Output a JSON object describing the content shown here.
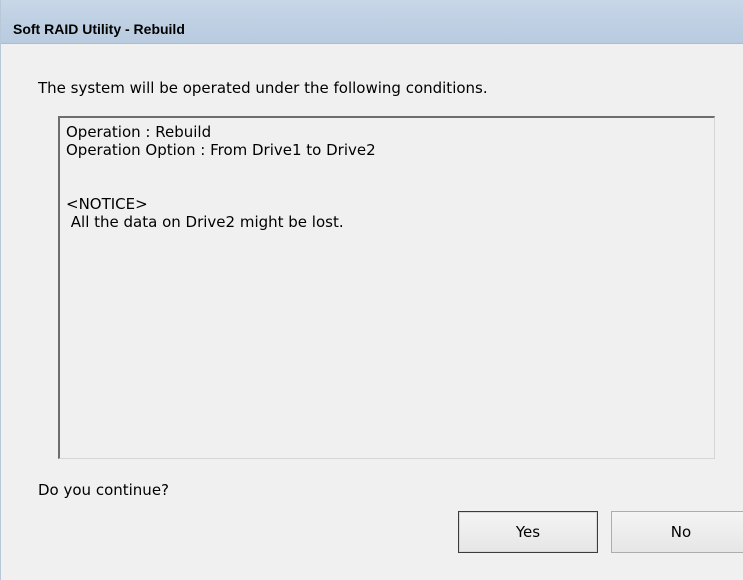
{
  "window": {
    "title": "Soft RAID Utility - Rebuild"
  },
  "dialog": {
    "intro": "The system will be operated under the following conditions.",
    "details": {
      "operation": "Operation : Rebuild",
      "option": "Operation Option : From Drive1 to Drive2",
      "notice_header": "<NOTICE>",
      "notice_text": " All the data on Drive2 might be lost."
    },
    "question": "Do you continue?",
    "buttons": {
      "yes": "Yes",
      "no": "No"
    }
  }
}
